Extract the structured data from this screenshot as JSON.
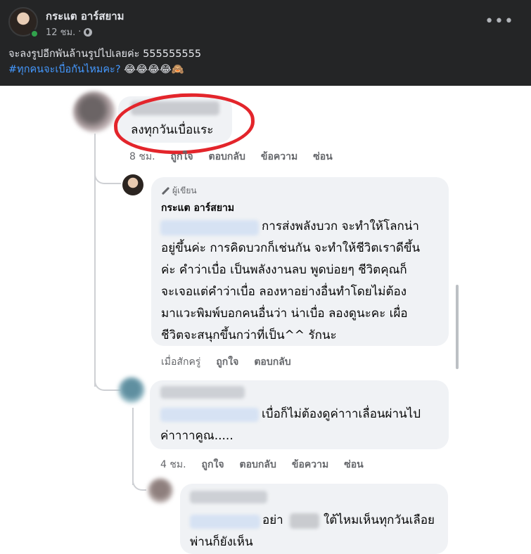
{
  "post": {
    "author": "กระแต อาร์สยาม",
    "time": "12 ชม.",
    "dot": "·",
    "text": "จะลงรูปอีกพันล้านรูปไปเลยค่ะ 555555555",
    "hashtag": "#ทุกคนจะเบื่อกันไหมคะ?",
    "emojis": " 😂😂😂😂🙈"
  },
  "comment1": {
    "text": "ลงทุกวันเบื่อแระ",
    "time": "8 ชม.",
    "like": "ถูกใจ",
    "reply": "ตอบกลับ",
    "message": "ข้อความ",
    "hide": "ซ่อน"
  },
  "reply1": {
    "badge": "ผู้เขียน",
    "name": "กระแต อาร์สยาม",
    "lines": [
      "การส่งพลังบวก จะทำให้โลกน่า",
      "อยู่ขึ้นค่ะ การคิดบวกก็เช่นกัน จะทำให้ชีวิตเราดีขึ้น",
      "ค่ะ คำว่าเบื่อ เป็นพลังงานลบ พูดบ่อยๆ ชีวิตคุณก็",
      "จะเจอแต่คำว่าเบื่อ  ลองหาอย่างอื่นทำโดยไม่ต้อง",
      "มาแวะพิมพ์บอกคนอื่นว่า น่าเบื่อ ลองดูนะคะ เผื่อ",
      "ชีวิตจะสนุกขึ้นกว่าที่เป็น^^ รักนะ"
    ],
    "time": "เมื่อสักครู่",
    "like": "ถูกใจ",
    "reply": "ตอบกลับ"
  },
  "comment2": {
    "lines": [
      "เบื่อก็ไม่ต้องดูค่าาาเลื่อนผ่านไป",
      "ค่าาาาคูณ....."
    ],
    "time": "4 ชม.",
    "like": "ถูกใจ",
    "reply": "ตอบกลับ",
    "message": "ข้อความ",
    "hide": "ซ่อน"
  },
  "comment3": {
    "line1a": "อย่า",
    "line1b": "ใต้ไหมเห็นทุกวันเลือย",
    "line2": "พ่านก็ยังเห็น"
  },
  "colors": {
    "header_bg": "#242526",
    "hashtag": "#4599ff",
    "annotation_red": "#e3252b",
    "bubble": "#f0f2f5"
  }
}
